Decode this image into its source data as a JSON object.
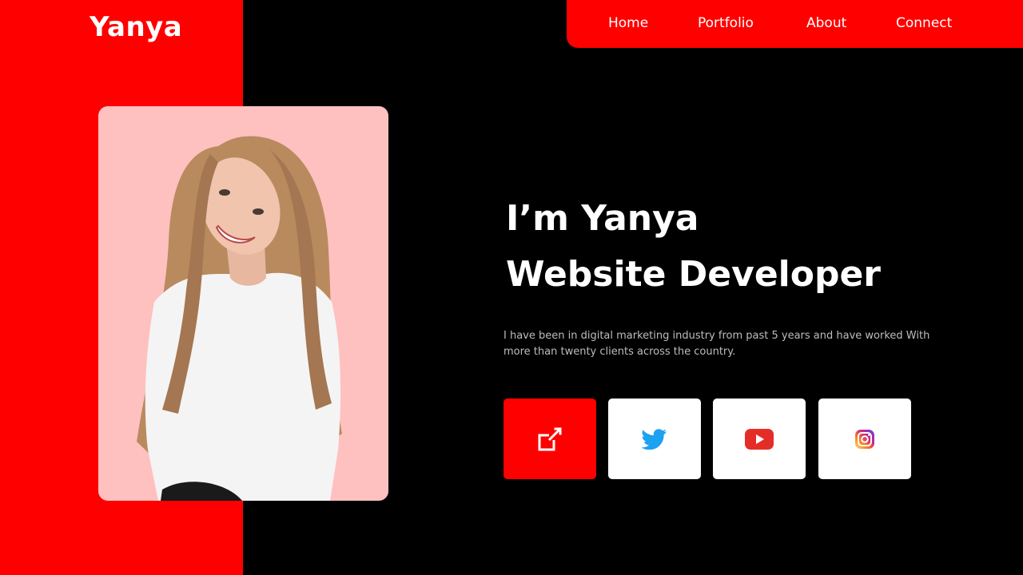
{
  "brand": {
    "logo_text": "Yanya"
  },
  "nav": {
    "items": [
      {
        "label": "Home"
      },
      {
        "label": "Portfolio"
      },
      {
        "label": "About"
      },
      {
        "label": "Connect"
      }
    ]
  },
  "hero": {
    "title_line1": "I’m Yanya",
    "title_line2": "Website Developer",
    "description": "I have been in digital marketing industry from past 5 years and have worked With more than twenty clients across the country."
  },
  "social": {
    "buttons": [
      {
        "icon": "external-link-icon"
      },
      {
        "icon": "twitter-icon"
      },
      {
        "icon": "youtube-icon"
      },
      {
        "icon": "instagram-icon"
      }
    ]
  },
  "colors": {
    "accent": "#ff0000",
    "background": "#000000",
    "card_bg": "#ffc0c0",
    "text": "#ffffff",
    "muted_text": "#bdbdbd",
    "twitter": "#1da1f2",
    "youtube": "#e52d27"
  }
}
